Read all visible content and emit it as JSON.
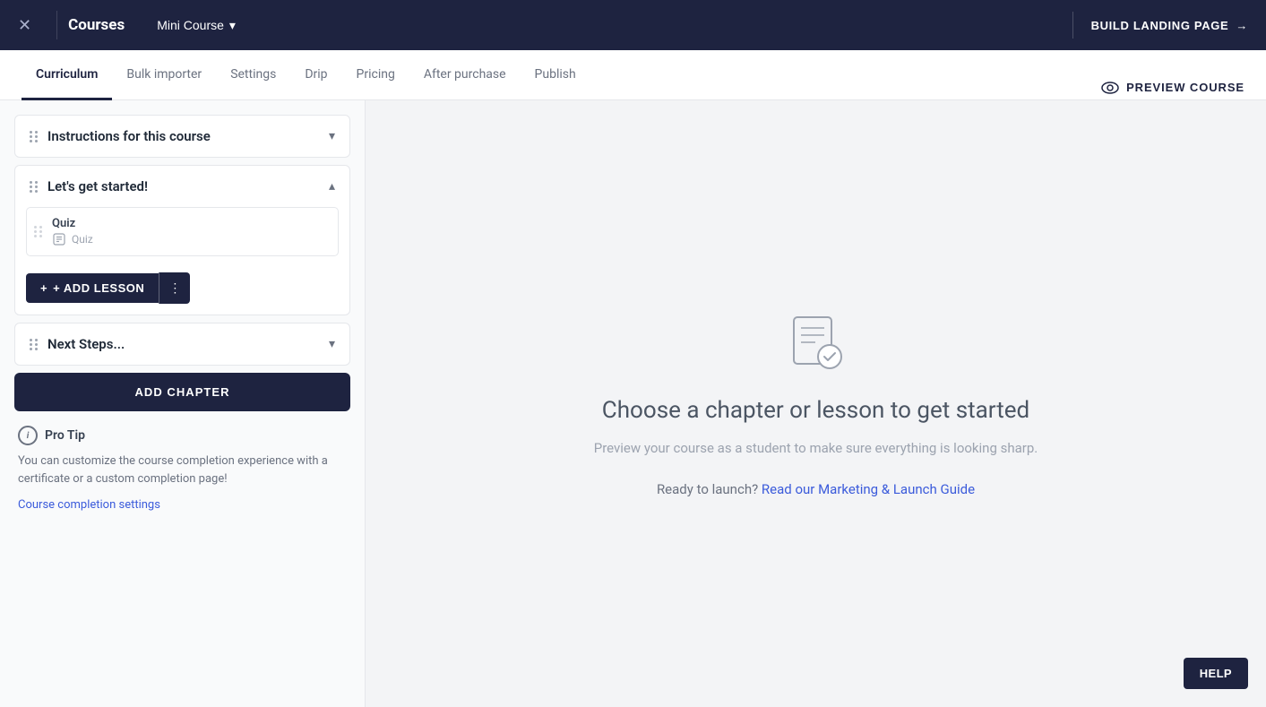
{
  "topbar": {
    "close_icon": "×",
    "title": "Courses",
    "course_name": "Mini Course",
    "dropdown_icon": "▾",
    "build_landing": "BUILD LANDING PAGE",
    "arrow_icon": "→"
  },
  "tabs": {
    "items": [
      {
        "label": "Curriculum",
        "active": true
      },
      {
        "label": "Bulk importer",
        "active": false
      },
      {
        "label": "Settings",
        "active": false
      },
      {
        "label": "Drip",
        "active": false
      },
      {
        "label": "Pricing",
        "active": false
      },
      {
        "label": "After purchase",
        "active": false
      },
      {
        "label": "Publish",
        "active": false
      }
    ],
    "preview_label": "PREVIEW COURSE"
  },
  "sidebar": {
    "chapters": [
      {
        "id": "instructions",
        "title": "Instructions for this course",
        "expanded": false,
        "lessons": []
      },
      {
        "id": "get-started",
        "title": "Let's get started!",
        "expanded": true,
        "lessons": [
          {
            "name": "Quiz",
            "type": "quiz"
          }
        ]
      },
      {
        "id": "next-steps",
        "title": "Next Steps...",
        "expanded": false,
        "lessons": []
      }
    ],
    "add_lesson_label": "+ ADD LESSON",
    "add_lesson_more": "⋮",
    "add_chapter_label": "ADD CHAPTER",
    "pro_tip": {
      "label": "Pro Tip",
      "text": "You can customize the course completion experience with a certificate or a custom completion page!",
      "link_label": "Course completion settings"
    }
  },
  "main": {
    "empty_title": "Choose a chapter or lesson to get started",
    "empty_subtitle": "Preview your course as a student to make sure everything is looking sharp.",
    "launch_prefix": "Ready to launch?",
    "launch_link": "Read our Marketing & Launch Guide"
  },
  "help_label": "HELP"
}
